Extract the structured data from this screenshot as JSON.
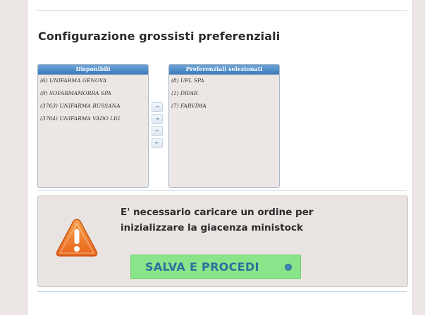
{
  "section": {
    "title": "Configurazione grossisti preferenziali"
  },
  "available": {
    "header": "Disponibili",
    "items": [
      "(6) UNIFARMA GENOVA",
      "(9) SOFARMAMORRA SPA",
      "(3763) UNIFARMA BUSSANA",
      "(3764) UNIFARMA VADO LIG"
    ]
  },
  "selected": {
    "header": "Preferenziali selezionati",
    "items": [
      "(8) UFL SPA",
      "(1) DIFAR",
      "(7) FARVIMA"
    ]
  },
  "move_buttons": {
    "add": "→",
    "add_all": "⇥",
    "remove": "←",
    "remove_all": "⇤"
  },
  "notice": {
    "line1": "E' necessario caricare un ordine per",
    "line2": "inizializzare la giacenza ministock",
    "icon": "warning-icon",
    "button_label": "SALVA E PROCEDI"
  },
  "colors": {
    "header_blue": "#3d7cbf",
    "button_green": "#88e58a",
    "button_text": "#2d6f9e",
    "warning_orange": "#f07e26"
  }
}
